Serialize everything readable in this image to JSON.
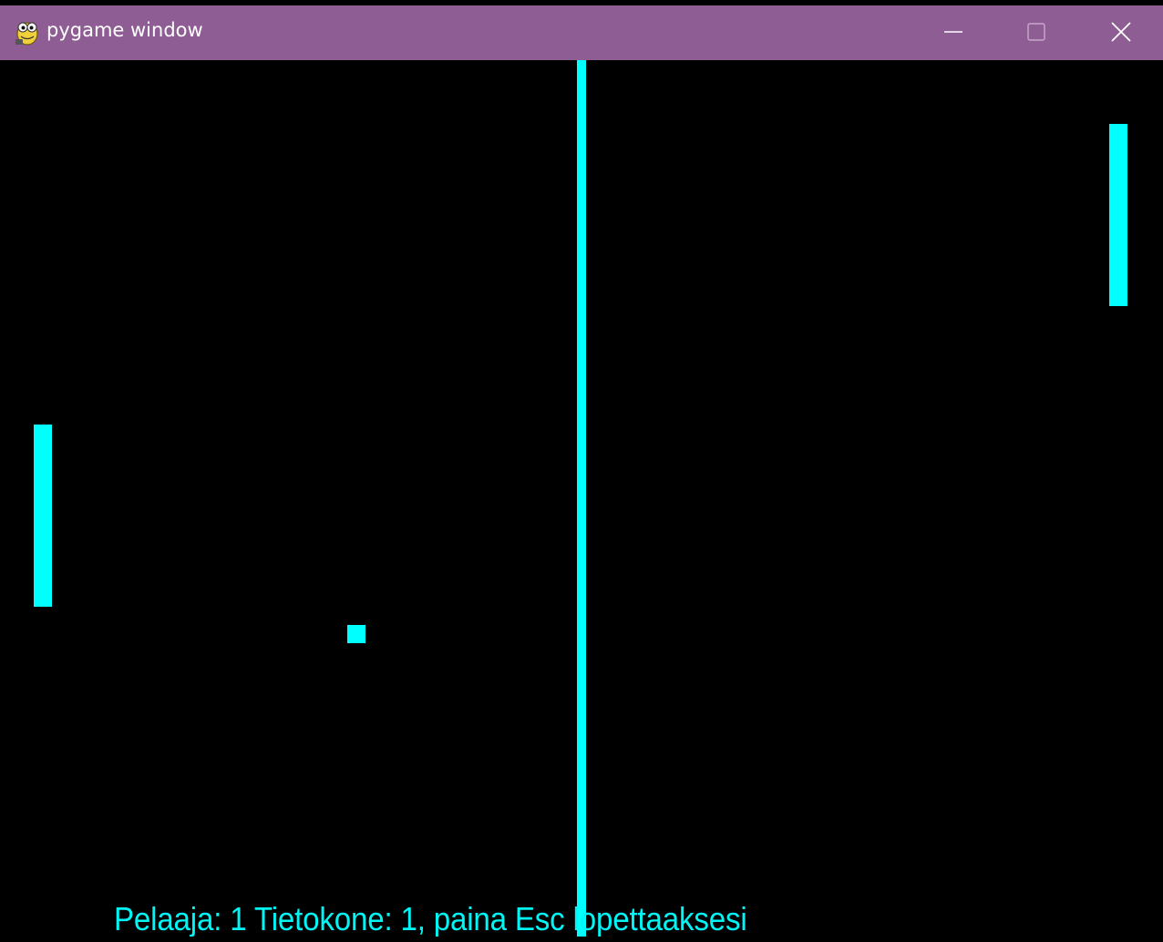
{
  "window": {
    "title": "pygame window",
    "app_icon": "pygame-snake-icon",
    "controls": {
      "minimize_icon": "minimize-icon",
      "maximize_icon": "maximize-icon",
      "close_icon": "close-icon"
    },
    "titlebar_color": "#8e5d94"
  },
  "game": {
    "background_color": "#000000",
    "foreground_color": "#00ffff",
    "status_text": "Pelaaja: 1 Tietokone: 1, paina Esc lopettaaksesi"
  }
}
